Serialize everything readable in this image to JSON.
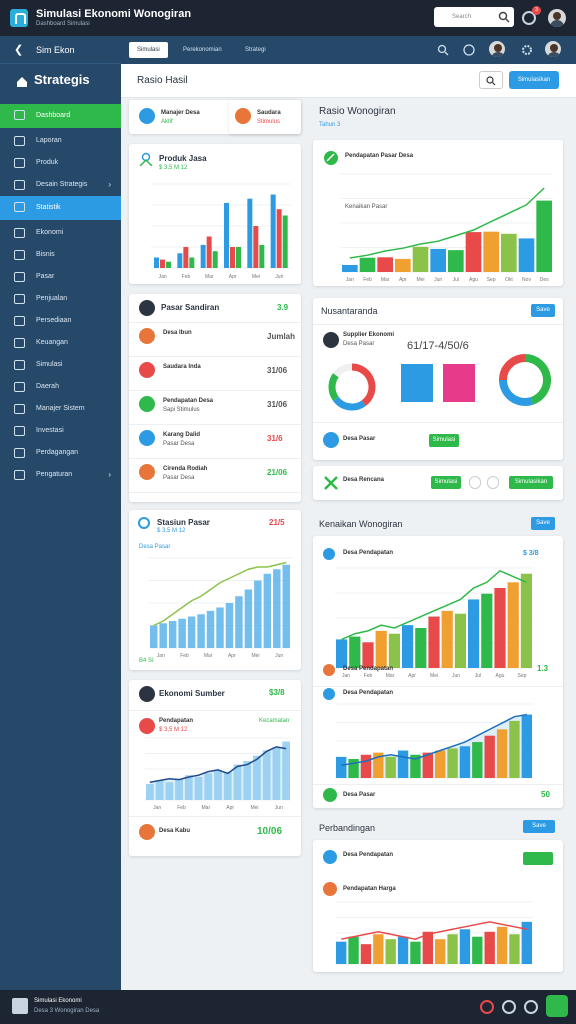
{
  "app": {
    "title": "Simulasi Ekonomi Wonogiran",
    "subtitle": "Dashboard Simulasi"
  },
  "search": {
    "placeholder": "Search"
  },
  "notif_count": "3",
  "colors": {
    "accent": "#2d9be3",
    "success": "#2fb94a",
    "danger": "#e84a4a",
    "sidebar": "#26496a",
    "topbar": "#1c2531"
  },
  "sidebar": {
    "header": "Sim Ekon",
    "section": "Strategis",
    "items": [
      {
        "label": "Dashboard",
        "icon": "home-icon"
      },
      {
        "label": "Laporan",
        "icon": "report-icon"
      },
      {
        "label": "Produk",
        "icon": "box-icon"
      },
      {
        "label": "Desain Strategis",
        "icon": "design-icon"
      },
      {
        "label": "Statistik",
        "icon": "stats-icon"
      },
      {
        "label": "Ekonomi",
        "icon": "economy-icon"
      },
      {
        "label": "Bisnis",
        "icon": "business-icon"
      },
      {
        "label": "Pasar",
        "icon": "market-icon"
      },
      {
        "label": "Penjualan",
        "icon": "sales-icon"
      },
      {
        "label": "Persediaan",
        "icon": "inventory-icon"
      },
      {
        "label": "Keuangan",
        "icon": "finance-icon"
      },
      {
        "label": "Simulasi",
        "icon": "simulation-icon"
      },
      {
        "label": "Daerah",
        "icon": "region-icon"
      },
      {
        "label": "Manajer Sistem",
        "icon": "manager-icon"
      },
      {
        "label": "Investasi",
        "icon": "invest-icon"
      },
      {
        "label": "Perdagangan",
        "icon": "trade-icon"
      },
      {
        "label": "Pengaturan",
        "icon": "settings-icon"
      }
    ]
  },
  "tabs": [
    "Simulasi",
    "Perekonomian",
    "Strategi"
  ],
  "header": {
    "title": "Rasio Hasil",
    "btn": "Simulasikan"
  },
  "profile_pair": [
    {
      "name": "Manajer Desa",
      "sub": "Aktif"
    },
    {
      "name": "Saudara",
      "sub": "Stimulus"
    }
  ],
  "card_bar": {
    "title": "Produk Jasa",
    "sub": "$ 3,5 M 12"
  },
  "list_card": {
    "title": "Pasar Sandiran",
    "value": "3.9",
    "header": "Jumlah",
    "rows": [
      {
        "name": "Desa Ibun",
        "sub": "",
        "value": "Jumlah",
        "color": "#e8763b"
      },
      {
        "name": "Saudara Inda",
        "sub": "",
        "value": "31/06",
        "color": "#e84a4a"
      },
      {
        "name": "Pendapatan Desa",
        "sub": "Sapi Stimulus",
        "value": "31/06",
        "color": "#2fb94a"
      },
      {
        "name": "Karang Dalid",
        "sub": "Pasar Desa",
        "value": "31/6",
        "color": "#2d9be3"
      },
      {
        "name": "Cirenda Rodiah",
        "sub": "Pasar Desa",
        "value": "21/06",
        "color": "#e8763b"
      }
    ]
  },
  "card_area1": {
    "title": "Stasiun Pasar",
    "sub": "$ 3,5 M 12",
    "sub2": "Desa Pasar",
    "value": "21/5",
    "foot": "B4 SI"
  },
  "card_area2": {
    "title": "Ekonomi Sumber",
    "value": "$3/8",
    "row_title": "Pendapatan",
    "row_sub": "$ 3,5 M 12",
    "row_val": "Kecamatan",
    "foot_name": "Desa Kabu",
    "foot_val": "10/06"
  },
  "right_top": {
    "title": "Rasio Wonogiran",
    "sub": "Tahun 3",
    "chart_title": "Pendapatan Pasar Desa",
    "chart_sub": "Kenaikan Pasar"
  },
  "network": {
    "title": "Nusantaranda",
    "btn": "Save",
    "person": "Supplier Ekonomi",
    "person_sub": "Desa Pasar",
    "big": "61/17-4/50/6",
    "foot_name": "Desa Pasar",
    "foot_btn": "Simulasi"
  },
  "action_bar": {
    "label": "Desa Rencana",
    "btn1": "Simulasi",
    "btn2": "Simulasikan"
  },
  "right_mid": {
    "title": "Kenaikan Wonogiran",
    "btn": "Save",
    "chart_title": "Desa Pendapatan",
    "chart_value": "$ 3/8",
    "legend1": "Desa Pendapatan",
    "legend1_val": "1.3",
    "chart2_title": "Desa Pendapatan",
    "foot_name": "Desa Pasar",
    "foot_val": "50"
  },
  "right_bottom": {
    "title": "Perbandingan",
    "btn": "Save",
    "chart_title": "Desa Pendapatan",
    "chart_sub": "Pendapatan Harga"
  },
  "footer": {
    "title": "Simulasi Ekonomi",
    "sub": "Desa 3 Wonogiran Desa"
  },
  "chart_data": [
    {
      "type": "bar",
      "categories": [
        "Jan",
        "Feb",
        "Mar",
        "Apr",
        "Mei",
        "Jun"
      ],
      "series": [
        {
          "values": [
            10,
            14,
            22,
            62,
            66,
            70
          ],
          "color": "#2d9be3"
        },
        {
          "values": [
            8,
            20,
            30,
            20,
            40,
            56
          ],
          "color": "#e84a4a"
        },
        {
          "values": [
            6,
            10,
            16,
            20,
            22,
            50
          ],
          "color": "#2fb94a"
        }
      ],
      "ylim": [
        0,
        80
      ]
    },
    {
      "type": "bar",
      "categories": [
        "Jan",
        "Feb",
        "Mar",
        "Apr",
        "Mei",
        "Jun",
        "Jul",
        "Agu",
        "Sep",
        "Okt",
        "Nov",
        "Des"
      ],
      "line": [
        10,
        12,
        15,
        17,
        20,
        22,
        26,
        30,
        36,
        42,
        48,
        60
      ],
      "ylim": [
        0,
        70
      ]
    },
    {
      "type": "area",
      "x": [
        "Jan",
        "Feb",
        "Mar",
        "Apr",
        "Mei",
        "Jun"
      ],
      "bars": [
        20,
        22,
        24,
        26,
        28,
        30,
        33,
        36,
        40,
        46,
        52,
        60,
        66,
        70,
        74
      ],
      "line": [
        20,
        24,
        30,
        36,
        42,
        46,
        52,
        58,
        62,
        66,
        70,
        72,
        72,
        74,
        76
      ],
      "ylim": [
        0,
        80
      ]
    },
    {
      "type": "area",
      "x": [
        "Jan",
        "Feb",
        "Mar",
        "Apr",
        "Mei",
        "Jun"
      ],
      "bars": [
        18,
        22,
        20,
        24,
        28,
        26,
        30,
        34,
        32,
        40,
        44,
        50,
        56,
        60,
        66
      ],
      "line": [
        20,
        22,
        24,
        23,
        26,
        28,
        32,
        34,
        30,
        38,
        40,
        46,
        55,
        60,
        58
      ],
      "ylim": [
        0,
        70
      ]
    },
    {
      "type": "pie",
      "values": [
        40,
        25,
        20,
        15
      ],
      "colors": [
        "#e84a4a",
        "#2d9be3",
        "#2fb94a",
        "#f0f0f0"
      ]
    },
    {
      "type": "bar",
      "x": [
        "Jan",
        "Feb",
        "Mar",
        "Apr",
        "Mei",
        "Jun",
        "Jul",
        "Agu",
        "Sep"
      ],
      "bars": [
        20,
        22,
        18,
        26,
        24,
        30,
        28,
        36,
        40,
        38,
        48,
        52,
        56,
        60,
        66
      ],
      "line": [
        20,
        24,
        26,
        30,
        28,
        32,
        36,
        40,
        44,
        48,
        56,
        60,
        68,
        64,
        60
      ],
      "ylim": [
        0,
        70
      ]
    },
    {
      "type": "bar",
      "bars": [
        20,
        18,
        22,
        24,
        20,
        26,
        22,
        24,
        26,
        28,
        30,
        34,
        40,
        46,
        54,
        60
      ],
      "line": [
        12,
        14,
        16,
        20,
        22,
        20,
        18,
        22,
        26,
        30,
        34,
        40,
        46,
        52,
        58,
        60
      ],
      "ylim": [
        0,
        70
      ]
    },
    {
      "type": "bar",
      "bars": [
        18,
        22,
        16,
        24,
        20,
        22,
        18,
        26,
        20,
        24,
        28,
        22,
        26,
        30,
        24,
        34
      ],
      "line": [
        20,
        22,
        24,
        26,
        24,
        22,
        20,
        24,
        26,
        28,
        30,
        32,
        34,
        32,
        30,
        28
      ],
      "ylim": [
        0,
        50
      ]
    },
    {
      "type": "pie",
      "values": [
        45,
        30,
        25
      ],
      "colors": [
        "#2fb94a",
        "#2d9be3",
        "#e84a4a"
      ]
    }
  ]
}
